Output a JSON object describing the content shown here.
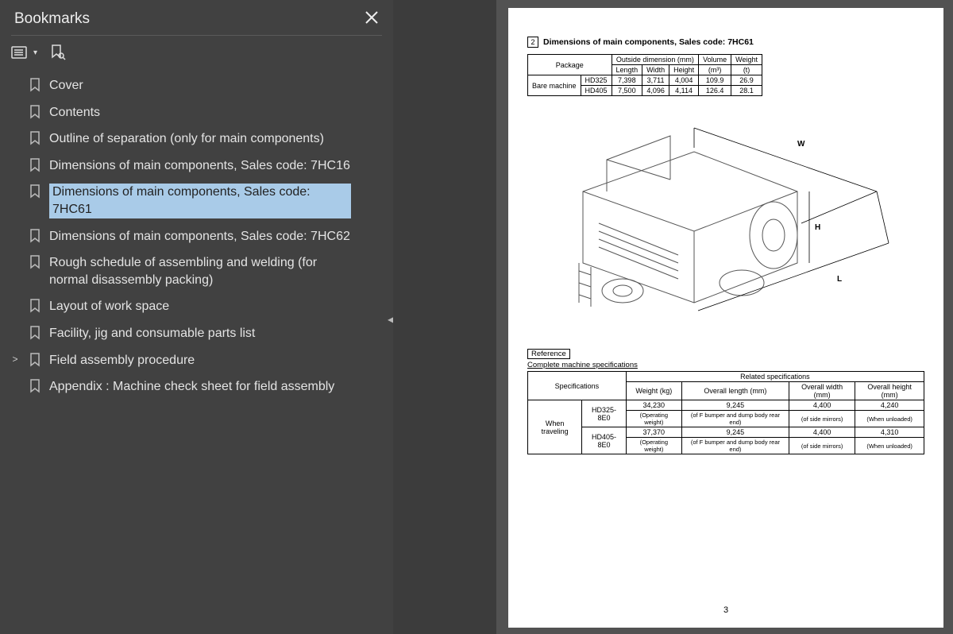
{
  "sidebar": {
    "title": "Bookmarks",
    "items": [
      {
        "label": "Cover",
        "expandable": false
      },
      {
        "label": "Contents",
        "expandable": false
      },
      {
        "label": "Outline of separation (only for main components)",
        "expandable": false
      },
      {
        "label": "Dimensions of main components, Sales code: 7HC16",
        "expandable": false
      },
      {
        "label": "Dimensions of main components, Sales code: 7HC61",
        "expandable": false,
        "selected": true
      },
      {
        "label": "Dimensions of main components, Sales code: 7HC62",
        "expandable": false
      },
      {
        "label": "Rough schedule of assembling and welding (for normal disassembly packing)",
        "expandable": false
      },
      {
        "label": "Layout of work space",
        "expandable": false
      },
      {
        "label": "Facility, jig and consumable parts list",
        "expandable": false
      },
      {
        "label": "Field assembly procedure",
        "expandable": true
      },
      {
        "label": "Appendix : Machine check sheet for field assembly",
        "expandable": false
      }
    ]
  },
  "doc": {
    "section_number": "2",
    "section_title": "Dimensions of main components, Sales code: 7HC61",
    "package_table": {
      "row_header": "Package",
      "group_header": "Outside dimension (mm)",
      "col_vol": "Volume",
      "col_wt": "Weight",
      "cols": [
        "Length",
        "Width",
        "Height",
        "(m³)",
        "(t)"
      ],
      "side_header": "Bare machine",
      "rows": [
        {
          "model": "HD325",
          "length": "7,398",
          "width": "3,711",
          "height": "4,004",
          "vol": "109.9",
          "wt": "26.9"
        },
        {
          "model": "HD405",
          "length": "7,500",
          "width": "4,096",
          "height": "4,114",
          "vol": "126.4",
          "wt": "28.1"
        }
      ]
    },
    "dims": {
      "W": "W",
      "H": "H",
      "L": "L"
    },
    "reference_label": "Reference",
    "reference_sub": "Complete machine specifications",
    "spec_table": {
      "head_specs": "Specifications",
      "head_related": "Related specifications",
      "cols": [
        "Weight (kg)",
        "Overall length (mm)",
        "Overall width (mm)",
        "Overall height (mm)"
      ],
      "side": "When traveling",
      "rows": [
        {
          "model": "HD325-8E0",
          "weight": "34,230",
          "len": "9,245",
          "wid": "4,400",
          "hgt": "4,240",
          "wnote": "(Operating weight)",
          "lnote": "(of F bumper and dump body rear end)",
          "widnote": "(of side mirrors)",
          "hnote": "(When unloaded)"
        },
        {
          "model": "HD405-8E0",
          "weight": "37,370",
          "len": "9,245",
          "wid": "4,400",
          "hgt": "4,310",
          "wnote": "(Operating weight)",
          "lnote": "(of F bumper and dump body rear end)",
          "widnote": "(of side mirrors)",
          "hnote": "(When unloaded)"
        }
      ]
    },
    "page_number": "3"
  }
}
